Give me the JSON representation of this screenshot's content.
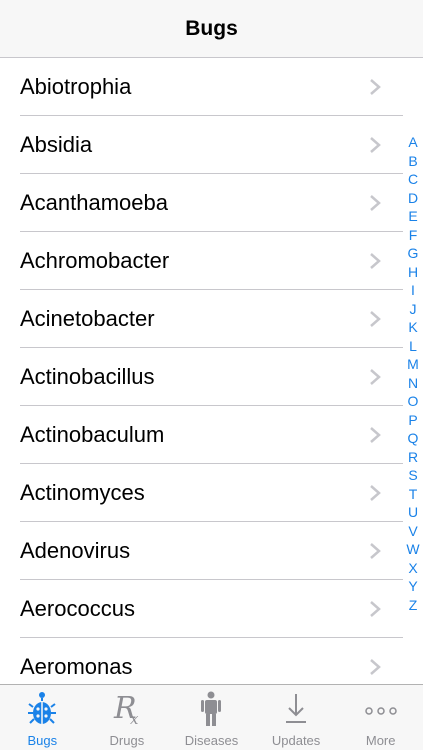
{
  "navbar": {
    "title": "Bugs"
  },
  "list": {
    "items": [
      "Abiotrophia",
      "Absidia",
      "Acanthamoeba",
      "Achromobacter",
      "Acinetobacter",
      "Actinobacillus",
      "Actinobaculum",
      "Actinomyces",
      "Adenovirus",
      "Aerococcus",
      "Aeromonas"
    ]
  },
  "index": {
    "letters": [
      "A",
      "B",
      "C",
      "D",
      "E",
      "F",
      "G",
      "H",
      "I",
      "J",
      "K",
      "L",
      "M",
      "N",
      "O",
      "P",
      "Q",
      "R",
      "S",
      "T",
      "U",
      "V",
      "W",
      "X",
      "Y",
      "Z"
    ]
  },
  "tabbar": {
    "tabs": [
      {
        "label": "Bugs",
        "icon": "bug-icon",
        "active": true
      },
      {
        "label": "Drugs",
        "icon": "rx-icon",
        "active": false
      },
      {
        "label": "Diseases",
        "icon": "person-icon",
        "active": false
      },
      {
        "label": "Updates",
        "icon": "download-icon",
        "active": false
      },
      {
        "label": "More",
        "icon": "more-icon",
        "active": false
      }
    ]
  },
  "colors": {
    "accent": "#1a82e8",
    "inactive": "#8e8e93",
    "separator": "#c8c7cc",
    "bar": "#f7f7f7"
  }
}
